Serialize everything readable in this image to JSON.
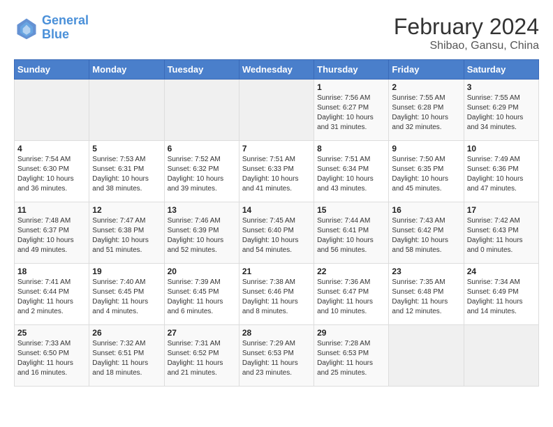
{
  "header": {
    "logo_line1": "General",
    "logo_line2": "Blue",
    "title": "February 2024",
    "subtitle": "Shibao, Gansu, China"
  },
  "weekdays": [
    "Sunday",
    "Monday",
    "Tuesday",
    "Wednesday",
    "Thursday",
    "Friday",
    "Saturday"
  ],
  "weeks": [
    [
      {
        "day": "",
        "info": ""
      },
      {
        "day": "",
        "info": ""
      },
      {
        "day": "",
        "info": ""
      },
      {
        "day": "",
        "info": ""
      },
      {
        "day": "1",
        "info": "Sunrise: 7:56 AM\nSunset: 6:27 PM\nDaylight: 10 hours\nand 31 minutes."
      },
      {
        "day": "2",
        "info": "Sunrise: 7:55 AM\nSunset: 6:28 PM\nDaylight: 10 hours\nand 32 minutes."
      },
      {
        "day": "3",
        "info": "Sunrise: 7:55 AM\nSunset: 6:29 PM\nDaylight: 10 hours\nand 34 minutes."
      }
    ],
    [
      {
        "day": "4",
        "info": "Sunrise: 7:54 AM\nSunset: 6:30 PM\nDaylight: 10 hours\nand 36 minutes."
      },
      {
        "day": "5",
        "info": "Sunrise: 7:53 AM\nSunset: 6:31 PM\nDaylight: 10 hours\nand 38 minutes."
      },
      {
        "day": "6",
        "info": "Sunrise: 7:52 AM\nSunset: 6:32 PM\nDaylight: 10 hours\nand 39 minutes."
      },
      {
        "day": "7",
        "info": "Sunrise: 7:51 AM\nSunset: 6:33 PM\nDaylight: 10 hours\nand 41 minutes."
      },
      {
        "day": "8",
        "info": "Sunrise: 7:51 AM\nSunset: 6:34 PM\nDaylight: 10 hours\nand 43 minutes."
      },
      {
        "day": "9",
        "info": "Sunrise: 7:50 AM\nSunset: 6:35 PM\nDaylight: 10 hours\nand 45 minutes."
      },
      {
        "day": "10",
        "info": "Sunrise: 7:49 AM\nSunset: 6:36 PM\nDaylight: 10 hours\nand 47 minutes."
      }
    ],
    [
      {
        "day": "11",
        "info": "Sunrise: 7:48 AM\nSunset: 6:37 PM\nDaylight: 10 hours\nand 49 minutes."
      },
      {
        "day": "12",
        "info": "Sunrise: 7:47 AM\nSunset: 6:38 PM\nDaylight: 10 hours\nand 51 minutes."
      },
      {
        "day": "13",
        "info": "Sunrise: 7:46 AM\nSunset: 6:39 PM\nDaylight: 10 hours\nand 52 minutes."
      },
      {
        "day": "14",
        "info": "Sunrise: 7:45 AM\nSunset: 6:40 PM\nDaylight: 10 hours\nand 54 minutes."
      },
      {
        "day": "15",
        "info": "Sunrise: 7:44 AM\nSunset: 6:41 PM\nDaylight: 10 hours\nand 56 minutes."
      },
      {
        "day": "16",
        "info": "Sunrise: 7:43 AM\nSunset: 6:42 PM\nDaylight: 10 hours\nand 58 minutes."
      },
      {
        "day": "17",
        "info": "Sunrise: 7:42 AM\nSunset: 6:43 PM\nDaylight: 11 hours\nand 0 minutes."
      }
    ],
    [
      {
        "day": "18",
        "info": "Sunrise: 7:41 AM\nSunset: 6:44 PM\nDaylight: 11 hours\nand 2 minutes."
      },
      {
        "day": "19",
        "info": "Sunrise: 7:40 AM\nSunset: 6:45 PM\nDaylight: 11 hours\nand 4 minutes."
      },
      {
        "day": "20",
        "info": "Sunrise: 7:39 AM\nSunset: 6:45 PM\nDaylight: 11 hours\nand 6 minutes."
      },
      {
        "day": "21",
        "info": "Sunrise: 7:38 AM\nSunset: 6:46 PM\nDaylight: 11 hours\nand 8 minutes."
      },
      {
        "day": "22",
        "info": "Sunrise: 7:36 AM\nSunset: 6:47 PM\nDaylight: 11 hours\nand 10 minutes."
      },
      {
        "day": "23",
        "info": "Sunrise: 7:35 AM\nSunset: 6:48 PM\nDaylight: 11 hours\nand 12 minutes."
      },
      {
        "day": "24",
        "info": "Sunrise: 7:34 AM\nSunset: 6:49 PM\nDaylight: 11 hours\nand 14 minutes."
      }
    ],
    [
      {
        "day": "25",
        "info": "Sunrise: 7:33 AM\nSunset: 6:50 PM\nDaylight: 11 hours\nand 16 minutes."
      },
      {
        "day": "26",
        "info": "Sunrise: 7:32 AM\nSunset: 6:51 PM\nDaylight: 11 hours\nand 18 minutes."
      },
      {
        "day": "27",
        "info": "Sunrise: 7:31 AM\nSunset: 6:52 PM\nDaylight: 11 hours\nand 21 minutes."
      },
      {
        "day": "28",
        "info": "Sunrise: 7:29 AM\nSunset: 6:53 PM\nDaylight: 11 hours\nand 23 minutes."
      },
      {
        "day": "29",
        "info": "Sunrise: 7:28 AM\nSunset: 6:53 PM\nDaylight: 11 hours\nand 25 minutes."
      },
      {
        "day": "",
        "info": ""
      },
      {
        "day": "",
        "info": ""
      }
    ]
  ]
}
